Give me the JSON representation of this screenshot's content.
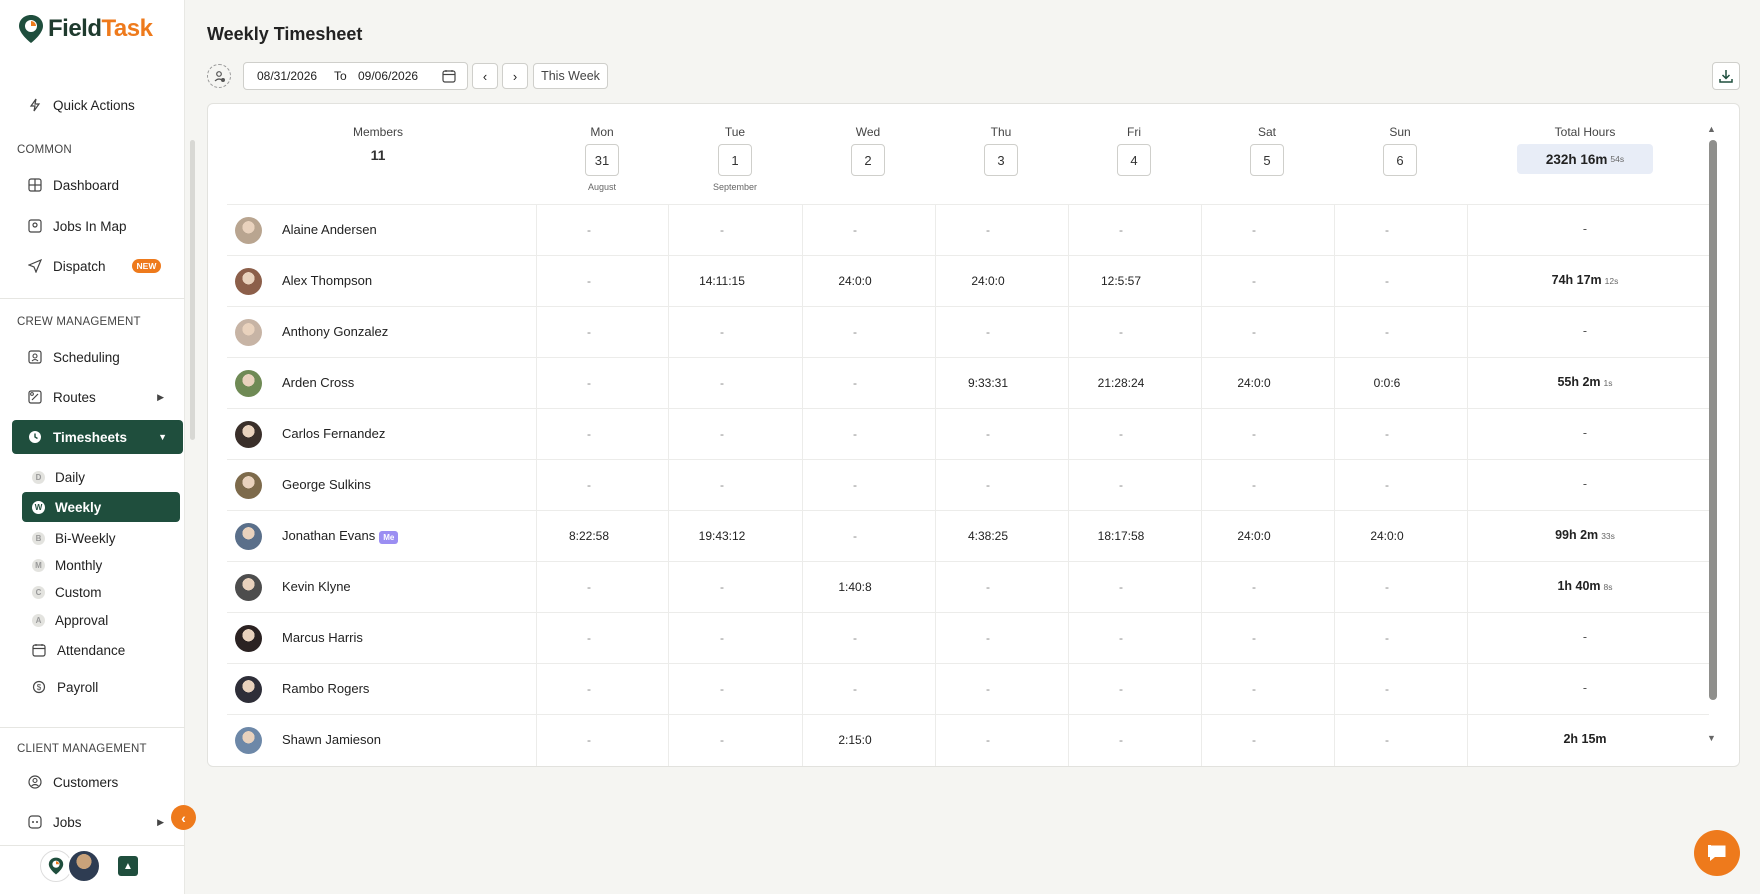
{
  "brand": {
    "name_part1": "Field",
    "name_part2": "Task",
    "primary": "#1f4e3d",
    "accent": "#ee7a1c"
  },
  "sidebar": {
    "quick_actions": "Quick Actions",
    "sections": {
      "common": "COMMON",
      "crew": "CREW MANAGEMENT",
      "client": "CLIENT MANAGEMENT"
    },
    "items": {
      "dashboard": "Dashboard",
      "jobs_in_map": "Jobs In Map",
      "dispatch": "Dispatch",
      "dispatch_badge": "NEW",
      "scheduling": "Scheduling",
      "routes": "Routes",
      "timesheets": "Timesheets",
      "attendance": "Attendance",
      "payroll": "Payroll",
      "customers": "Customers",
      "jobs": "Jobs"
    },
    "timesheet_sub": [
      {
        "letter": "D",
        "label": "Daily"
      },
      {
        "letter": "W",
        "label": "Weekly"
      },
      {
        "letter": "B",
        "label": "Bi-Weekly"
      },
      {
        "letter": "M",
        "label": "Monthly"
      },
      {
        "letter": "C",
        "label": "Custom"
      },
      {
        "letter": "A",
        "label": "Approval"
      }
    ]
  },
  "header": {
    "title": "Weekly Timesheet",
    "from_date": "08/31/2026",
    "to_label": "To",
    "to_date": "09/06/2026",
    "this_week": "This Week"
  },
  "table": {
    "members_label": "Members",
    "members_count": "11",
    "total_label": "Total Hours",
    "total_main": "232h 16m",
    "total_seconds": "54s",
    "days": [
      {
        "name": "Mon",
        "date": "31",
        "month": "August"
      },
      {
        "name": "Tue",
        "date": "1",
        "month": "September"
      },
      {
        "name": "Wed",
        "date": "2",
        "month": ""
      },
      {
        "name": "Thu",
        "date": "3",
        "month": ""
      },
      {
        "name": "Fri",
        "date": "4",
        "month": ""
      },
      {
        "name": "Sat",
        "date": "5",
        "month": ""
      },
      {
        "name": "Sun",
        "date": "6",
        "month": ""
      }
    ],
    "rows": [
      {
        "name": "Alaine Andersen",
        "me": "",
        "avatar": "#b9a590",
        "cells": [
          "-",
          "-",
          "-",
          "-",
          "-",
          "-",
          "-"
        ],
        "total": "-",
        "total_s": ""
      },
      {
        "name": "Alex Thompson",
        "me": "",
        "avatar": "#8c5f4a",
        "cells": [
          "-",
          "14:11:15",
          "24:0:0",
          "24:0:0",
          "12:5:57",
          "-",
          "-"
        ],
        "total": "74h 17m",
        "total_s": "12s"
      },
      {
        "name": "Anthony Gonzalez",
        "me": "",
        "avatar": "#c7b4a5",
        "cells": [
          "-",
          "-",
          "-",
          "-",
          "-",
          "-",
          "-"
        ],
        "total": "-",
        "total_s": ""
      },
      {
        "name": "Arden Cross",
        "me": "",
        "avatar": "#6f8a55",
        "cells": [
          "-",
          "-",
          "-",
          "9:33:31",
          "21:28:24",
          "24:0:0",
          "0:0:6"
        ],
        "total": "55h 2m",
        "total_s": "1s"
      },
      {
        "name": "Carlos Fernandez",
        "me": "",
        "avatar": "#3a2f2a",
        "cells": [
          "-",
          "-",
          "-",
          "-",
          "-",
          "-",
          "-"
        ],
        "total": "-",
        "total_s": ""
      },
      {
        "name": "George Sulkins",
        "me": "",
        "avatar": "#7d6a4b",
        "cells": [
          "-",
          "-",
          "-",
          "-",
          "-",
          "-",
          "-"
        ],
        "total": "-",
        "total_s": ""
      },
      {
        "name": "Jonathan Evans",
        "me": "Me",
        "avatar": "#5a6f8a",
        "cells": [
          "8:22:58",
          "19:43:12",
          "-",
          "4:38:25",
          "18:17:58",
          "24:0:0",
          "24:0:0"
        ],
        "total": "99h 2m",
        "total_s": "33s"
      },
      {
        "name": "Kevin Klyne",
        "me": "",
        "avatar": "#4d4d4d",
        "cells": [
          "-",
          "-",
          "1:40:8",
          "-",
          "-",
          "-",
          "-"
        ],
        "total": "1h 40m",
        "total_s": "8s"
      },
      {
        "name": "Marcus Harris",
        "me": "",
        "avatar": "#2b2222",
        "cells": [
          "-",
          "-",
          "-",
          "-",
          "-",
          "-",
          "-"
        ],
        "total": "-",
        "total_s": ""
      },
      {
        "name": "Rambo Rogers",
        "me": "",
        "avatar": "#2e2e38",
        "cells": [
          "-",
          "-",
          "-",
          "-",
          "-",
          "-",
          "-"
        ],
        "total": "-",
        "total_s": ""
      },
      {
        "name": "Shawn Jamieson",
        "me": "",
        "avatar": "#6d88a8",
        "cells": [
          "-",
          "-",
          "2:15:0",
          "-",
          "-",
          "-",
          "-"
        ],
        "total": "2h 15m",
        "total_s": ""
      }
    ]
  },
  "icons": {
    "quick_actions": "bolt-icon",
    "dashboard": "grid-icon",
    "jobs_in_map": "map-icon",
    "dispatch": "send-icon",
    "scheduling": "calendar-user-icon",
    "routes": "route-icon",
    "timesheets": "clock-icon",
    "attendance": "calendar-icon",
    "payroll": "money-icon",
    "customers": "user-circle-icon",
    "jobs": "jobs-icon",
    "download": "download-icon",
    "chat": "chat-icon"
  }
}
